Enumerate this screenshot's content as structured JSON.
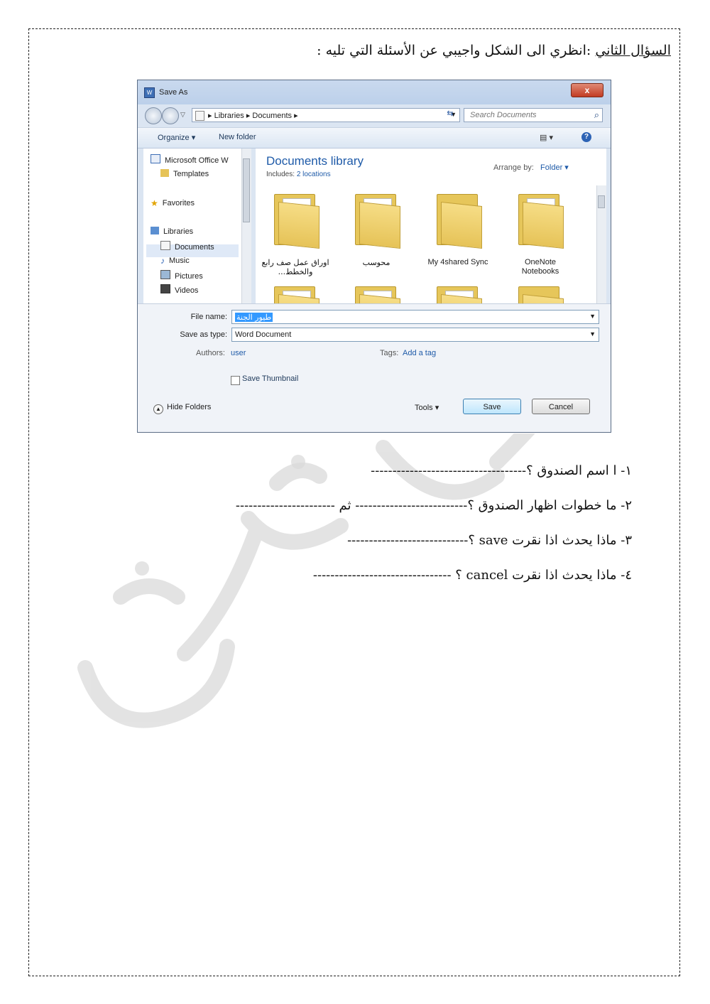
{
  "heading": {
    "label_underlined": "السؤال الثاني",
    "text": ":انظري الى الشكل واجيبي عن الأسئلة التي تليه :"
  },
  "dialog": {
    "title": "Save As",
    "close_glyph": "x",
    "breadcrumb": "▸ Libraries ▸ Documents ▸",
    "search_placeholder": "Search Documents",
    "toolbar": {
      "organize": "Organize ▾",
      "new_folder": "New folder"
    },
    "nav_pane": {
      "items": [
        "Microsoft Office W",
        "Templates",
        "Favorites",
        "Libraries",
        "Documents",
        "Music",
        "Pictures",
        "Videos"
      ]
    },
    "library": {
      "title": "Documents library",
      "includes_label": "Includes:",
      "includes_link": "2 locations",
      "arrange_label": "Arrange by:",
      "arrange_value": "Folder ▾"
    },
    "folders": [
      {
        "label": "اوراق عمل صف رابع والخطط..."
      },
      {
        "label": "محوسب"
      },
      {
        "label": "My 4shared Sync"
      },
      {
        "label": "OneNote Notebooks"
      }
    ],
    "form": {
      "file_name_label": "File name:",
      "file_name_value": "طيور الجنة",
      "save_type_label": "Save as type:",
      "save_type_value": "Word Document",
      "authors_label": "Authors:",
      "authors_value": "user",
      "tags_label": "Tags:",
      "tags_value": "Add a tag",
      "thumbnail_label": "Save Thumbnail",
      "hide_folders": "Hide Folders",
      "tools": "Tools ▾",
      "save_button": "Save",
      "cancel_button": "Cancel"
    }
  },
  "questions": [
    "١- ا اسم الصندوق ؟------------------------------------",
    "٢- ما خطوات اظهار الصندوق ؟-------------------------- ثم -----------------------",
    "٣- ماذا يحدث اذا نقرت save ؟----------------------------",
    "٤- ماذا يحدث اذا نقرت cancel ؟ --------------------------------"
  ]
}
